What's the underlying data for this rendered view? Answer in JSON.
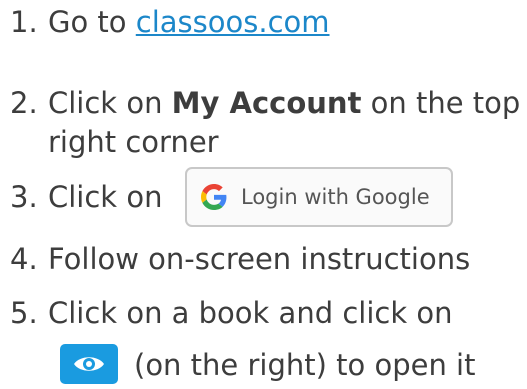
{
  "steps": [
    {
      "number": "1.",
      "prefix": "Go to ",
      "link": "classoos.com"
    },
    {
      "number": "2.",
      "prefix": "Click on ",
      "bold": "My Account",
      "suffix": " on the top",
      "continuation": "right corner"
    },
    {
      "number": "3.",
      "prefix": "Click on",
      "button_label": "Login with Google"
    },
    {
      "number": "4.",
      "text": "Follow on-screen instructions"
    },
    {
      "number": "5.",
      "text": "Click on a book and click on",
      "continuation": "(on the right) to open it"
    }
  ],
  "icons": {
    "google": "google-g-icon",
    "view": "eye-icon"
  },
  "colors": {
    "text": "#3d3d3d",
    "link": "#1c87c9",
    "eye_button": "#1a9be0",
    "button_border": "#c8c8c8"
  }
}
